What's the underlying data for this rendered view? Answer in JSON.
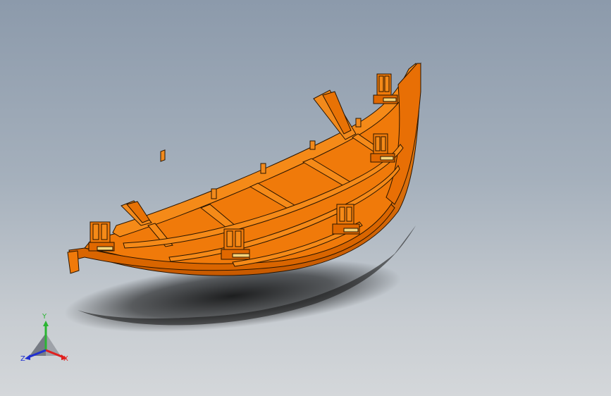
{
  "viewport": {
    "background_top": "#8c9aab",
    "background_bottom": "#d4d7da"
  },
  "model": {
    "part_color": "#f07a0a",
    "part_shadow": "#c85a00",
    "edge_color": "#2a1500",
    "clip_highlight": "#f5d47a"
  },
  "triad": {
    "x_label": "X",
    "y_label": "Y",
    "z_label": "Z",
    "x_color": "#e0201e",
    "y_color": "#2bb533",
    "z_color": "#2030d0"
  }
}
